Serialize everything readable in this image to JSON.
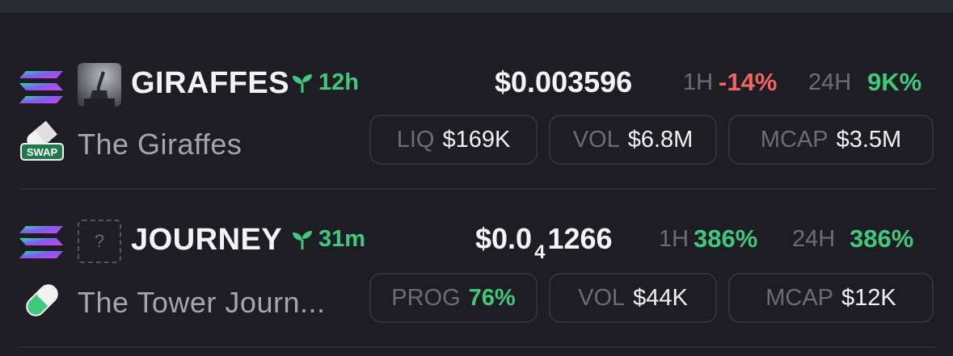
{
  "tokens": [
    {
      "symbol": "GIRAFFES",
      "age": "12h",
      "name": "The Giraffes",
      "price": "$0.003596",
      "h1_label": "1H",
      "h1_change": "-14%",
      "h24_label": "24H",
      "h24_change": "9K%",
      "badge_label": "SWAP",
      "stats": [
        {
          "key": "LIQ",
          "value": "$169K"
        },
        {
          "key": "VOL",
          "value": "$6.8M"
        },
        {
          "key": "MCAP",
          "value": "$3.5M"
        }
      ]
    },
    {
      "symbol": "JOURNEY",
      "age": "31m",
      "name": "The Tower Journ...",
      "price_main": "$0.0",
      "price_zeros": "4",
      "price_tail": "1266",
      "h1_label": "1H",
      "h1_change": "386%",
      "h24_label": "24H",
      "h24_change": "386%",
      "thumb_placeholder": "?",
      "stats": [
        {
          "key": "PROG",
          "value": "76%"
        },
        {
          "key": "VOL",
          "value": "$44K"
        },
        {
          "key": "MCAP",
          "value": "$12K"
        }
      ]
    }
  ],
  "colors": {
    "background": "#1e1d24",
    "positive": "#3ec97c",
    "negative": "#f06464",
    "muted": "#6d6c74"
  },
  "icons": [
    "solana-logo-icon",
    "seedling-icon",
    "pill-icon",
    "placeholder-image-icon"
  ]
}
